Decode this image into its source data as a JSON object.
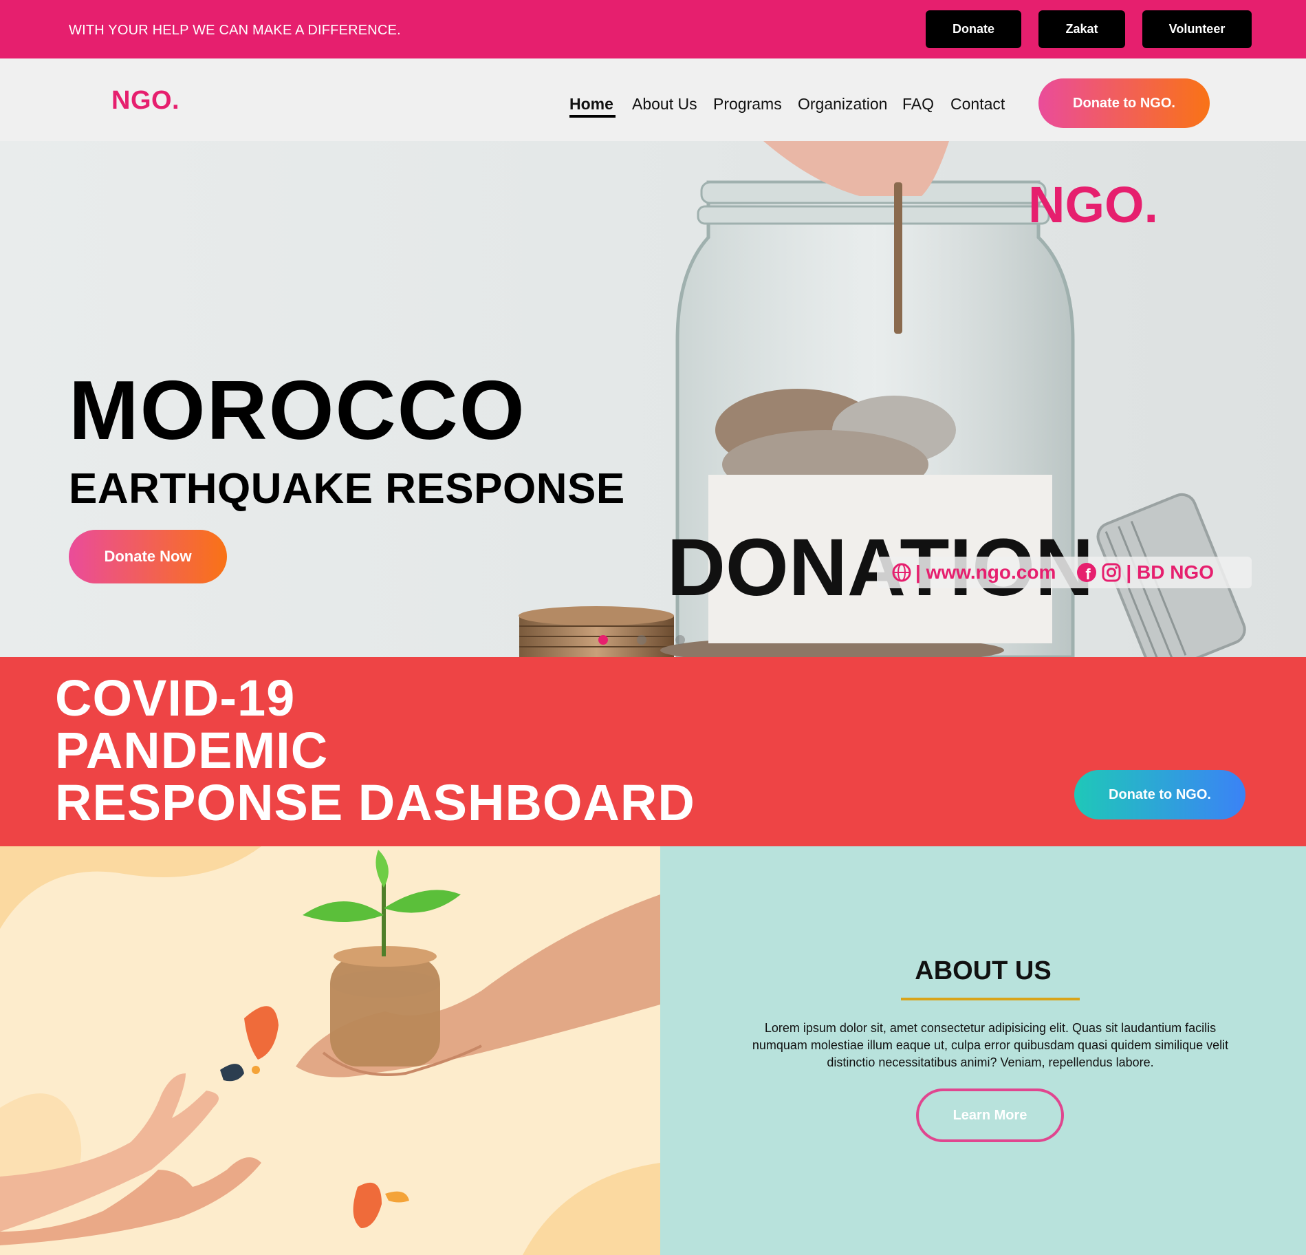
{
  "topbar": {
    "message": "WITH YOUR HELP WE CAN MAKE A DIFFERENCE.",
    "buttons": [
      {
        "label": "Donate"
      },
      {
        "label": "Zakat"
      },
      {
        "label": "Volunteer"
      }
    ]
  },
  "navbar": {
    "logo": "NGO.",
    "items": [
      {
        "label": "Home",
        "active": true
      },
      {
        "label": "About Us"
      },
      {
        "label": "Programs"
      },
      {
        "label": "Organization"
      },
      {
        "label": "FAQ"
      },
      {
        "label": "Contact"
      }
    ],
    "cta": "Donate to NGO."
  },
  "hero": {
    "title": "MOROCCO",
    "subtitle": "EARTHQUAKE RESPONSE",
    "cta": "Donate Now",
    "image_logo": "NGO.",
    "jar_label": "DONATION",
    "website": "| www.ngo.com",
    "social": "| BD NGO",
    "icons": [
      "globe-icon",
      "facebook-icon",
      "instagram-icon"
    ],
    "slides": 3,
    "active_slide": 0
  },
  "covid": {
    "line1": "COVID-19",
    "line2": "PANDEMIC",
    "line3": "RESPONSE DASHBOARD",
    "cta": "Donate to NGO."
  },
  "about": {
    "title": "ABOUT US",
    "text": "Lorem ipsum dolor sit, amet consectetur adipisicing elit. Quas sit laudantium facilis numquam molestiae illum eaque ut, culpa error quibusdam quasi quidem similique velit distinctio necessitatibus animi? Veniam, repellendus labore.",
    "button": "Learn More"
  },
  "colors": {
    "brand_pink": "#e61f6e",
    "covid_red": "#ee4445",
    "about_bg": "#b8e2dc",
    "accent_gold": "#d9a419"
  }
}
